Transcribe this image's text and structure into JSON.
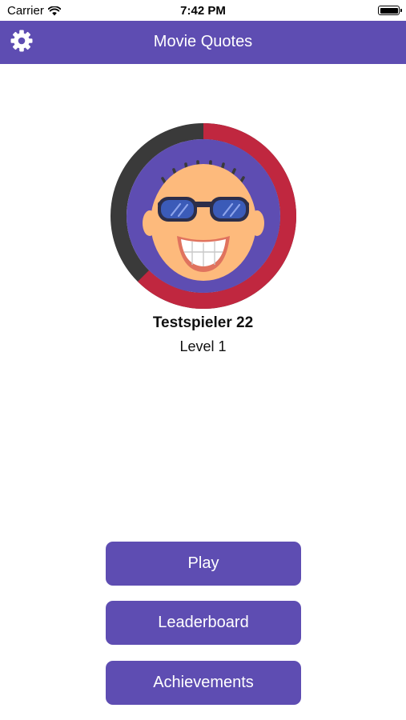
{
  "status_bar": {
    "carrier": "Carrier",
    "time": "7:42 PM",
    "wifi_icon": "wifi-icon",
    "battery_icon": "battery-icon"
  },
  "nav": {
    "title": "Movie Quotes",
    "settings_icon": "gear-icon"
  },
  "profile": {
    "name": "Testspieler 22",
    "level": "Level 1",
    "avatar_icon": "cartoon-face-sunglasses-avatar"
  },
  "buttons": {
    "play": "Play",
    "leaderboard": "Leaderboard",
    "achievements": "Achievements"
  },
  "colors": {
    "primary": "#5E4DB2",
    "progress": "#C0273F",
    "track": "#3A3A3A",
    "skin": "#FDBA7C",
    "background": "#FFFFFF"
  }
}
